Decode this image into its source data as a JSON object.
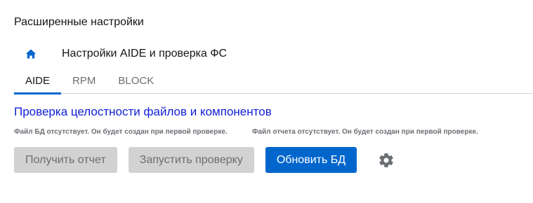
{
  "page": {
    "title": "Расширенные настройки"
  },
  "breadcrumb": {
    "home_icon": "home-icon",
    "label": "Настройки AIDE и проверка ФС"
  },
  "tabs": [
    {
      "label": "AIDE",
      "active": true
    },
    {
      "label": "RPM",
      "active": false
    },
    {
      "label": "BLOCK",
      "active": false
    }
  ],
  "section": {
    "heading": "Проверка целостности файлов и компонентов",
    "db_status": "Файл БД отсутствует. Он будет создан при первой проверке.",
    "report_status": "Файл отчета отсутствует. Он будет создан при первой проверке."
  },
  "actions": {
    "get_report_label": "Получить отчет",
    "run_check_label": "Запустить проверку",
    "update_db_label": "Обновить БД",
    "settings_icon": "gear-icon"
  },
  "colors": {
    "accent": "#0066cc",
    "link": "#0f1fd6",
    "disabled_bg": "#d2d2d2",
    "muted_text": "#6a6e73"
  }
}
